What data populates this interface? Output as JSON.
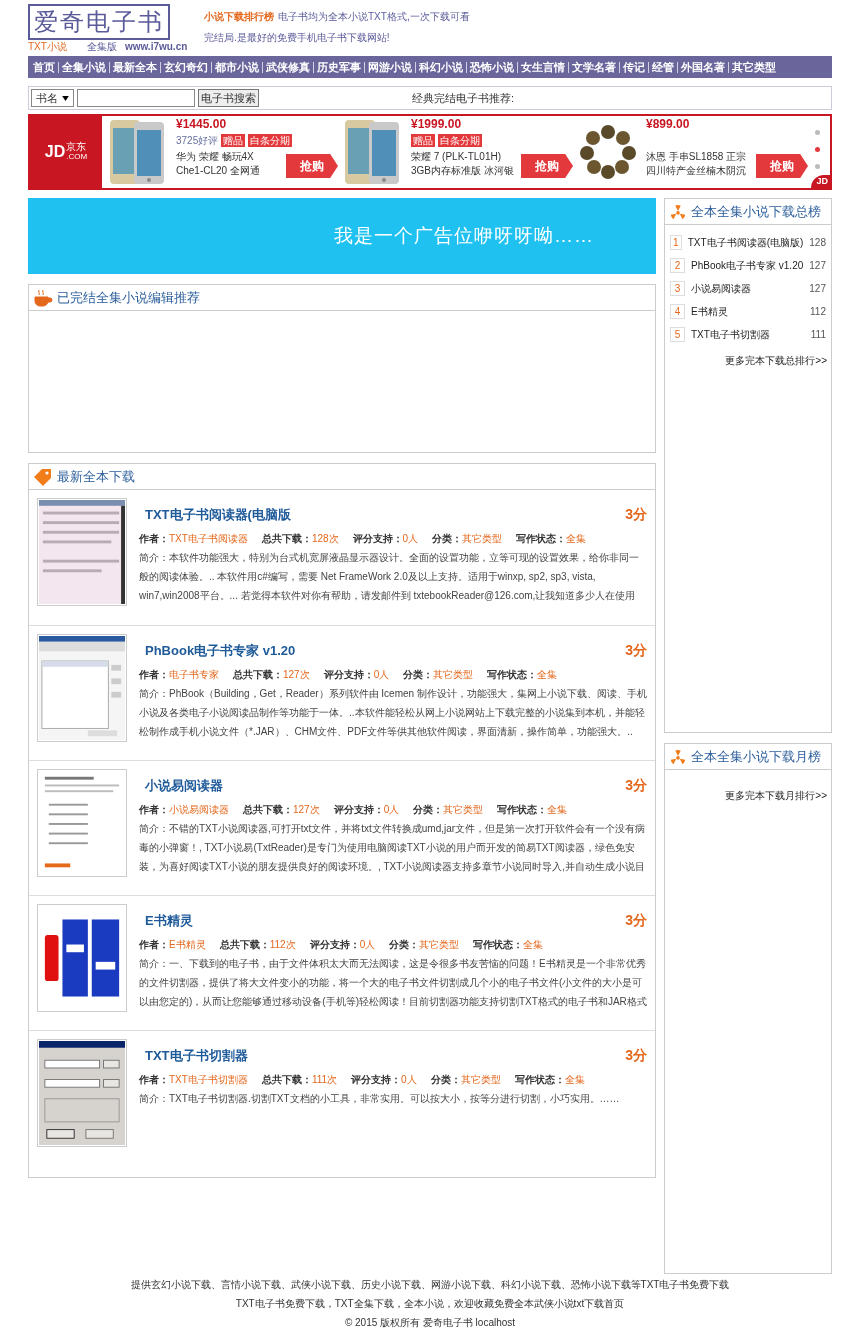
{
  "header": {
    "logo": {
      "title": "爱奇电子书",
      "sub_left": "TXT小说",
      "sub_mid": "全集版",
      "url": "www.i7wu.cn"
    },
    "tagline_link": "小说下载排行榜",
    "tagline": "电子书均为全本小说TXT格式,一次下载可看完结局.是最好的免费手机电子书下载网站!"
  },
  "nav": [
    "首页",
    "全集小说",
    "最新全本",
    "玄幻奇幻",
    "都市小说",
    "武侠修真",
    "历史军事",
    "网游小说",
    "科幻小说",
    "恐怖小说",
    "女生言情",
    "文学名著",
    "传记",
    "经管",
    "外国名著",
    "其它类型"
  ],
  "search": {
    "select": "书名",
    "button": "电子书搜索",
    "recommend_label": "经典完结电子书推荐:"
  },
  "jd_ad": {
    "logo_main": "JD",
    "logo_cn": "京东",
    "logo_dot": ".COM",
    "corner": "JD",
    "products": [
      {
        "price": "¥1445.00",
        "reviews": "3725好评",
        "tags": [
          "赠品",
          "白条分期"
        ],
        "name_lines": [
          "华为 荣耀 畅玩4X",
          "Che1-CL20 全网通"
        ],
        "button": "抢购",
        "kind": "phone"
      },
      {
        "price": "¥1999.00",
        "tags": [
          "赠品",
          "白条分期"
        ],
        "name_lines": [
          "荣耀 7 (PLK-TL01H)",
          "3GB内存标准版 冰河银"
        ],
        "button": "抢购",
        "kind": "phone"
      },
      {
        "price": "¥899.00",
        "name_lines": [
          "沐恩 手串SL1858 正宗",
          "四川特产金丝楠木阴沉"
        ],
        "button": "抢购",
        "kind": "beads"
      }
    ],
    "dots": [
      {
        "selected": false
      },
      {
        "selected": true
      },
      {
        "selected": false
      }
    ]
  },
  "banner": "我是一个广告位咿呀呀呦……",
  "editor_box": {
    "title": "已完结全集小说编辑推荐"
  },
  "latest": {
    "title": "最新全本下载",
    "items": [
      {
        "title": "TXT电子书阅读器(电脑版",
        "score": "3分",
        "kind": "doc",
        "meta": [
          {
            "label": "作者：",
            "value": "TXT电子书阅读器"
          },
          {
            "label": "总共下载：",
            "value": "128次"
          },
          {
            "label": "评分支持：",
            "value": "0人"
          },
          {
            "label": "分类：",
            "value": "其它类型"
          },
          {
            "label": "写作状态：",
            "value": "全集"
          }
        ],
        "intro": "简介：本软件功能强大，特别为台式机宽屏液晶显示器设计。全面的设置功能，立等可现的设置效果，给你非同一般的阅读体验。.. 本软件用c#编写，需要 Net FrameWork 2.0及以上支持。适用于winxp, sp2, sp3, vista, win7,win2008平台。... 若觉得本软件对你有帮助，请发邮件到 txtebookReader@126.com,让我知道多少人在使用"
      },
      {
        "title": "PhBook电子书专家 v1.20",
        "score": "3分",
        "kind": "grid",
        "meta": [
          {
            "label": "作者：",
            "value": "电子书专家"
          },
          {
            "label": "总共下载：",
            "value": "127次"
          },
          {
            "label": "评分支持：",
            "value": "0人"
          },
          {
            "label": "分类：",
            "value": "其它类型"
          },
          {
            "label": "写作状态：",
            "value": "全集"
          }
        ],
        "intro": "简介：PhBook（Building，Get，Reader）系列软件由 Icemen 制作设计，功能强大，集网上小说下载、阅读、手机小说及各类电子小说阅读品制作等功能于一体。..本软件能轻松从网上小说网站上下载完整的小说集到本机，并能轻松制作成手机小说文件（*.JAR）、CHM文件、PDF文件等供其他软件阅读，界面清新，操作简单，功能强大。.."
      },
      {
        "title": "小说易阅读器",
        "score": "3分",
        "kind": "list",
        "meta": [
          {
            "label": "作者：",
            "value": "小说易阅读器"
          },
          {
            "label": "总共下载：",
            "value": "127次"
          },
          {
            "label": "评分支持：",
            "value": "0人"
          },
          {
            "label": "分类：",
            "value": "其它类型"
          },
          {
            "label": "写作状态：",
            "value": "全集"
          }
        ],
        "intro": "简介：不错的TXT小说阅读器,可打开txt文件，并将txt文件转换成umd,jar文件，但是第一次打开软件会有一个没有病毒的小弹窗！, TXT小说易(TxtReader)是专门为使用电脑阅读TXT小说的用户而开发的简易TXT阅读器，绿色免安装，为喜好阅读TXT小说的朋友提供良好的阅读环境。, TXT小说阅读器支持多章节小说同时导入,并自动生成小说目"
      },
      {
        "title": "E书精灵",
        "score": "3分",
        "kind": "brand",
        "meta": [
          {
            "label": "作者：",
            "value": "E书精灵"
          },
          {
            "label": "总共下载：",
            "value": "112次"
          },
          {
            "label": "评分支持：",
            "value": "0人"
          },
          {
            "label": "分类：",
            "value": "其它类型"
          },
          {
            "label": "写作状态：",
            "value": "全集"
          }
        ],
        "intro": "简介：一、下载到的电子书，由于文件体积太大而无法阅读，这是令很多书友苦恼的问题！E书精灵是一个非常优秀的文件切割器，提供了将大文件变小的功能，将一个大的电子书文件切割成几个小的电子书文件(小文件的大小是可以由您定的)，从而让您能够通过移动设备(手机等)轻松阅读！目前切割器功能支持切割TXT格式的电子书和JAR格式"
      },
      {
        "title": "TXT电子书切割器",
        "score": "3分",
        "kind": "dialog",
        "meta": [
          {
            "label": "作者：",
            "value": "TXT电子书切割器"
          },
          {
            "label": "总共下载：",
            "value": "111次"
          },
          {
            "label": "评分支持：",
            "value": "0人"
          },
          {
            "label": "分类：",
            "value": "其它类型"
          },
          {
            "label": "写作状态：",
            "value": "全集"
          }
        ],
        "intro": "简介：TXT电子书切割器.切割TXT文档的小工具，非常实用。可以按大小，按等分进行切割，小巧实用。……"
      }
    ]
  },
  "sidebar": [
    {
      "title": "全本全集小说下载总榜",
      "ranks": [
        {
          "rank": "1",
          "name": "TXT电子书阅读器(电脑版)",
          "count": "128"
        },
        {
          "rank": "2",
          "name": "PhBook电子书专家 v1.20",
          "count": "127"
        },
        {
          "rank": "3",
          "name": "小说易阅读器",
          "count": "127"
        },
        {
          "rank": "4",
          "name": "E书精灵",
          "count": "112"
        },
        {
          "rank": "5",
          "name": "TXT电子书切割器",
          "count": "111"
        }
      ],
      "more": "更多完本下载总排行>>"
    },
    {
      "title": "全本全集小说下载月榜",
      "more": "更多完本下载月排行>>"
    }
  ],
  "footer": [
    "提供玄幻小说下载、言情小说下载、武侠小说下载、历史小说下载、网游小说下载、科幻小说下载、恐怖小说下载等TXT电子书免费下载",
    "TXT电子书免费下载，TXT全集下载，全本小说，欢迎收藏免费全本武侠小说txt下载首页",
    "© 2015 版权所有 爱奇电子书 localhost"
  ]
}
